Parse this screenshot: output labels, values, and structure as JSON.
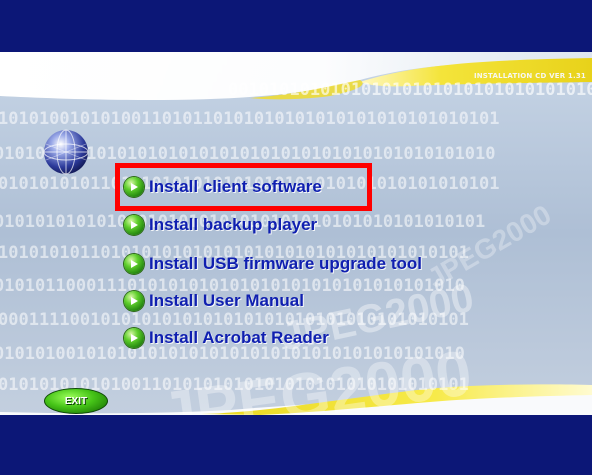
{
  "header": {
    "version_label": "INSTALLATION CD VER 1.31"
  },
  "background": {
    "watermark_text": "JPEG2000",
    "binary_rows": [
      "0010101010101010101010101010101010101011",
      "1010100101010011010110101010101010101010101010101",
      "0101010101010101010101010101010101010101010101010",
      "0101010101101010101010101010101010101010101010101",
      "010101010101010101010101010101010101010101010101",
      "1010101011010101010101010101010101010101010101",
      "0101011000111010101010101010101010101010101010",
      "0001111001010101010101010101010101010101010101",
      "0101010010101010101010101010101010101010101010",
      "0101010101010011010101010101010101010101010101"
    ]
  },
  "menu": {
    "items": [
      {
        "label": "Install client software"
      },
      {
        "label": "Install backup player"
      },
      {
        "label": "Install USB firmware upgrade tool"
      },
      {
        "label": "Install User Manual"
      },
      {
        "label": "Install Acrobat Reader"
      }
    ]
  },
  "exit": {
    "label": "EXIT"
  },
  "colors": {
    "navy": "#0c1777",
    "swoosh_yellow": "#f2df22",
    "label_blue": "#0f1fb0",
    "highlight_red": "#ff0000",
    "button_green": "#46c418"
  },
  "icons": {
    "menu_bullet": "green-play-bullet-icon",
    "globe": "globe-icon"
  }
}
